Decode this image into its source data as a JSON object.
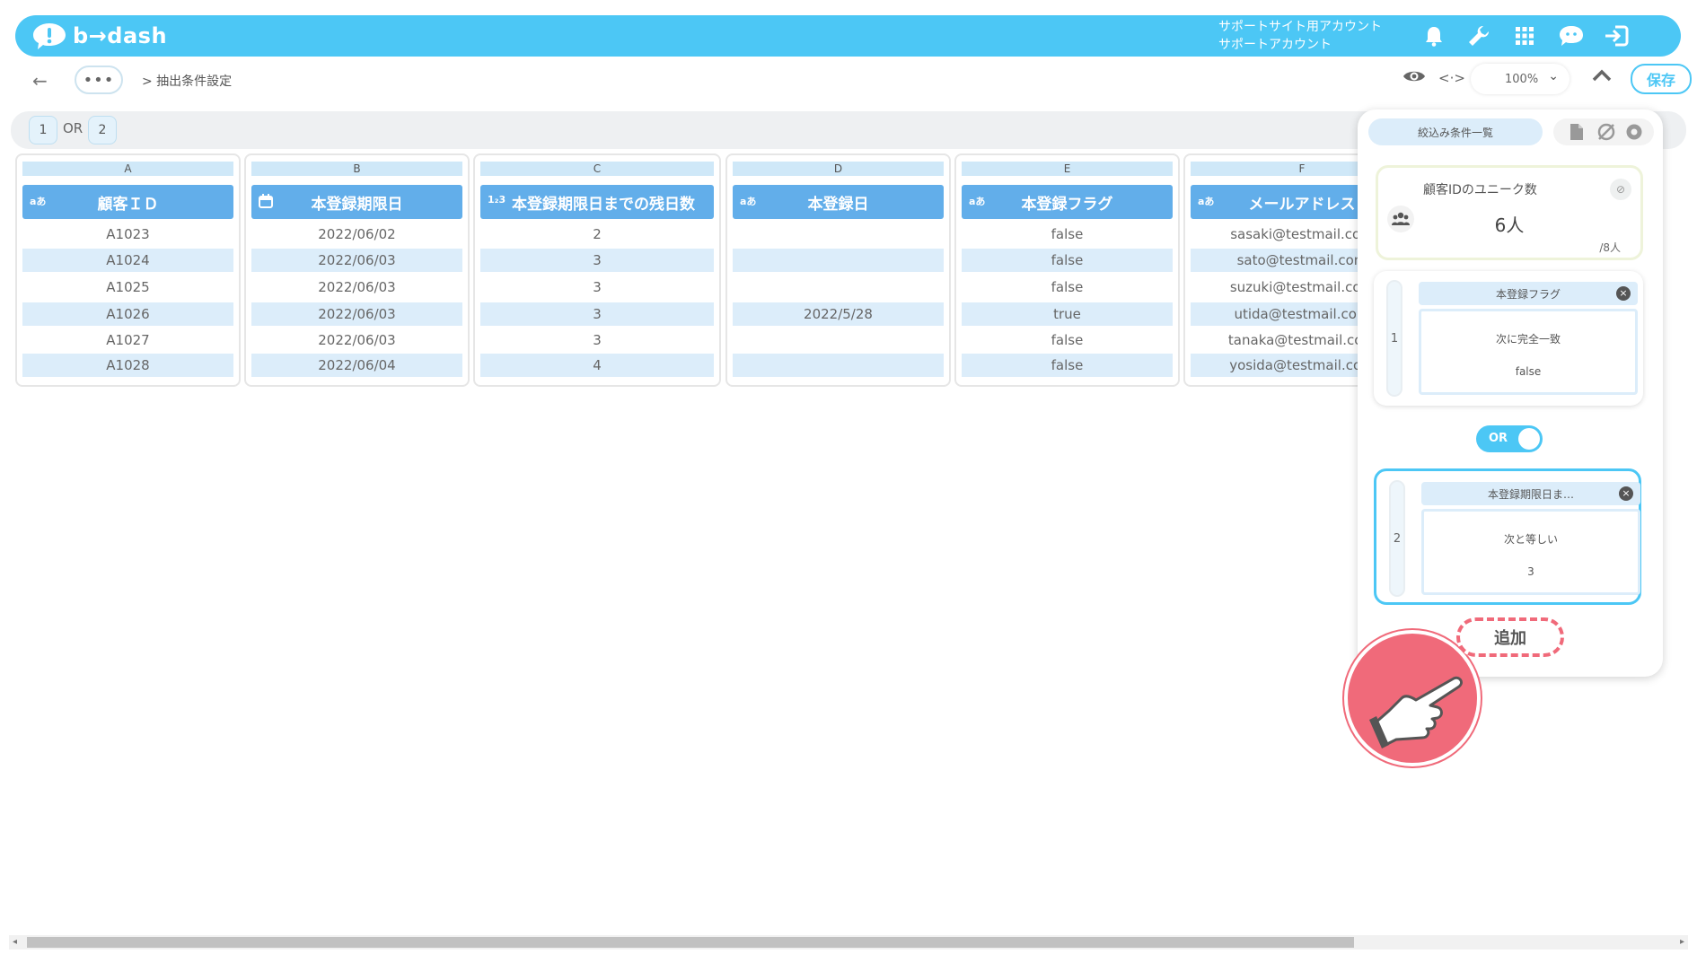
{
  "app": {
    "logo_text": "b→dash",
    "account_line1": "サポートサイト用アカウント",
    "account_line2": "サポートアカウント"
  },
  "header_icons": [
    "bell-icon",
    "wrench-icon",
    "grid-icon",
    "chat-icon",
    "logout-icon"
  ],
  "toolbar": {
    "back": "←",
    "more": "•••",
    "breadcrumb": "> 抽出条件設定",
    "zoom": "100%",
    "save_label": "保存"
  },
  "filterbar": {
    "chip1": "1",
    "operator": "OR",
    "chip2": "2"
  },
  "table": {
    "columns": [
      {
        "letter": "A",
        "type_icon": "aあ",
        "name": "顧客ＩＤ",
        "values": [
          "A1023",
          "A1024",
          "A1025",
          "A1026",
          "A1027",
          "A1028"
        ]
      },
      {
        "letter": "B",
        "type_icon": "calendar",
        "name": "本登録期限日",
        "values": [
          "2022/06/02",
          "2022/06/03",
          "2022/06/03",
          "2022/06/03",
          "2022/06/03",
          "2022/06/04"
        ]
      },
      {
        "letter": "C",
        "type_icon": "1₂3",
        "name": "本登録期限日までの残日数",
        "values": [
          "2",
          "3",
          "3",
          "3",
          "3",
          "4"
        ]
      },
      {
        "letter": "D",
        "type_icon": "aあ",
        "name": "本登録日",
        "values": [
          "",
          "",
          "",
          "2022/5/28",
          "",
          ""
        ]
      },
      {
        "letter": "E",
        "type_icon": "aあ",
        "name": "本登録フラグ",
        "values": [
          "false",
          "false",
          "false",
          "true",
          "false",
          "false"
        ]
      },
      {
        "letter": "F",
        "type_icon": "aあ",
        "name": "メールアドレス",
        "values": [
          "sasaki@testmail.com",
          "sato@testmail.com",
          "suzuki@testmail.com",
          "utida@testmail.com",
          "tanaka@testmail.com",
          "yosida@testmail.com"
        ]
      }
    ]
  },
  "panel": {
    "tab_label": "絞込み条件一覧",
    "stat": {
      "title": "顧客IDのユニーク数",
      "value": "6人",
      "total": "/8人"
    },
    "conditions": [
      {
        "index": "1",
        "field": "本登録フラグ",
        "operator": "次に完全一致",
        "value": "false"
      },
      {
        "index": "2",
        "field": "本登録期限日ま…",
        "operator": "次と等しい",
        "value": "3"
      }
    ],
    "logic_toggle": "OR",
    "add_label": "追加"
  },
  "colors": {
    "accent": "#4cc7f5",
    "column_header": "#62aeea",
    "row_alt": "#dcedfa",
    "highlight": "#f06a7a"
  }
}
